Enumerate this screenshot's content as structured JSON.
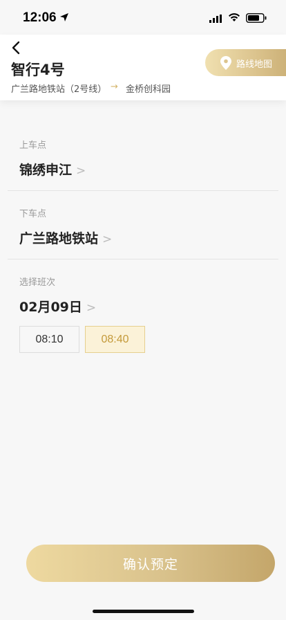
{
  "status_bar": {
    "time": "12:06"
  },
  "header": {
    "title": "智行4号",
    "route_from": "广兰路地铁站（2号线）",
    "route_arrow": "→",
    "route_to": "金桥创科园",
    "map_button_label": "路线地图"
  },
  "pickup": {
    "label": "上车点",
    "value": "锦绣申江"
  },
  "dropoff": {
    "label": "下车点",
    "value": "广兰路地铁站"
  },
  "schedule": {
    "label": "选择班次",
    "date": "02月09日",
    "times": [
      "08:10",
      "08:40"
    ],
    "selected_time": "08:40"
  },
  "chevron": ">",
  "confirm_label": "确认预定",
  "colors": {
    "accent_gold": "#d4b46a",
    "selected_text": "#c49a3a"
  }
}
